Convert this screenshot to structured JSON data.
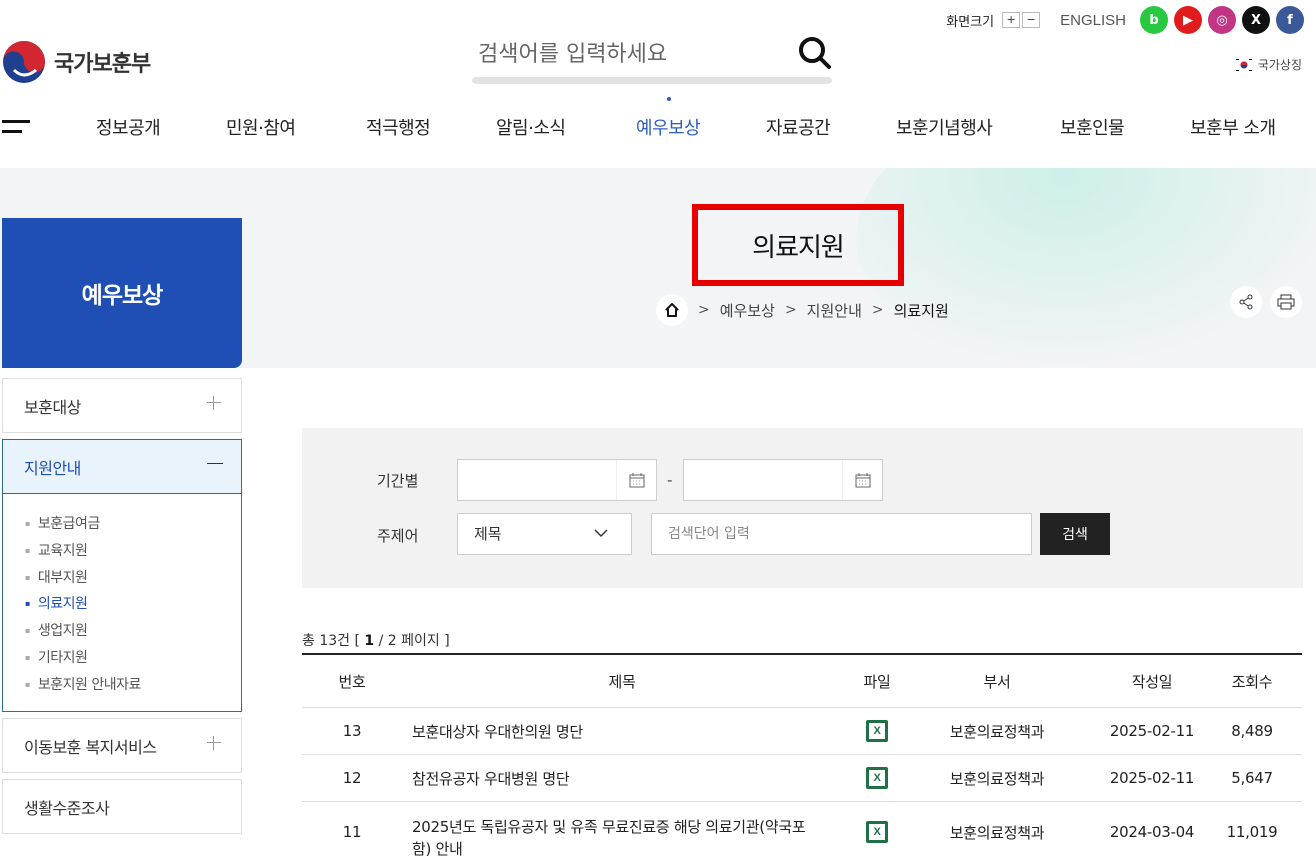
{
  "header": {
    "logo_name": "국가보훈부",
    "search_placeholder": "검색어를 입력하세요",
    "screen_size_label": "화면크기",
    "zoom_in": "+",
    "zoom_out": "−",
    "english_label": "ENGLISH",
    "national_symbol_label": "국가상징",
    "sns": [
      {
        "name": "blog",
        "glyph": "b",
        "color": "#28c940"
      },
      {
        "name": "youtube",
        "glyph": "▶",
        "color": "#e01c1c"
      },
      {
        "name": "instagram",
        "glyph": "◎",
        "color": "#c13584"
      },
      {
        "name": "x",
        "glyph": "X",
        "color": "#111111"
      },
      {
        "name": "facebook",
        "glyph": "f",
        "color": "#3b5998"
      }
    ]
  },
  "gnb": {
    "items": [
      "정보공개",
      "민원·참여",
      "적극행정",
      "알림·소식",
      "예우보상",
      "자료공간",
      "보훈기념행사",
      "보훈인물",
      "보훈부 소개"
    ],
    "active": "예우보상"
  },
  "visual": {
    "section_title": "예우보상",
    "page_title": "의료지원",
    "breadcrumb": [
      "예우보상",
      "지원안내",
      "의료지원"
    ]
  },
  "lnb": {
    "items": [
      {
        "label": "보훈대상"
      },
      {
        "label": "지원안내"
      },
      {
        "label": "이동보훈 복지서비스"
      },
      {
        "label": "생활수준조사"
      }
    ],
    "sub": [
      "보훈급여금",
      "교육지원",
      "대부지원",
      "의료지원",
      "생업지원",
      "기타지원",
      "보훈지원 안내자료"
    ]
  },
  "search": {
    "period_label": "기간별",
    "dash": "-",
    "subject_label": "주제어",
    "select_value": "제목",
    "keyword_placeholder": "검색단어 입력",
    "button": "검색"
  },
  "list": {
    "count_prefix": "총 13건",
    "page_current": "1",
    "page_rest": "/ 2 페이지",
    "bracket_open": "[",
    "bracket_close": "]",
    "headers": {
      "no": "번호",
      "title": "제목",
      "file": "파일",
      "dept": "부서",
      "date": "작성일",
      "views": "조회수"
    },
    "rows": [
      {
        "no": "13",
        "title": "보훈대상자 우대한의원 명단",
        "dept": "보훈의료정책과",
        "date": "2025-02-11",
        "views": "8,489"
      },
      {
        "no": "12",
        "title": "참전유공자 우대병원 명단",
        "dept": "보훈의료정책과",
        "date": "2025-02-11",
        "views": "5,647"
      },
      {
        "no": "11",
        "title": "2025년도 독립유공자 및 유족 무료진료증 해당 의료기관(약국포함) 안내",
        "dept": "보훈의료정책과",
        "date": "2024-03-04",
        "views": "11,019"
      }
    ]
  }
}
